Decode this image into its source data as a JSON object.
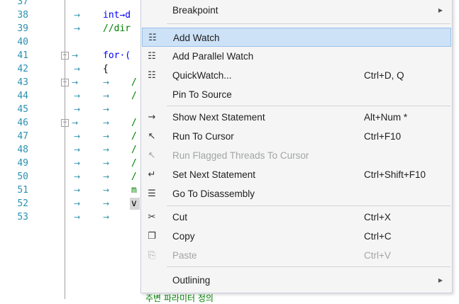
{
  "editor": {
    "lines": [
      {
        "num": "37",
        "code": ""
      },
      {
        "num": "38",
        "code": "int→d"
      },
      {
        "num": "39",
        "code": "//dir"
      },
      {
        "num": "40",
        "code": ""
      },
      {
        "num": "41",
        "code": "for·("
      },
      {
        "num": "42",
        "code": "{"
      },
      {
        "num": "43",
        "code": "/"
      },
      {
        "num": "44",
        "code": "/"
      },
      {
        "num": "45",
        "code": ""
      },
      {
        "num": "46",
        "code": "/"
      },
      {
        "num": "47",
        "code": "/"
      },
      {
        "num": "48",
        "code": "/"
      },
      {
        "num": "49",
        "code": "/"
      },
      {
        "num": "50",
        "code": "/"
      },
      {
        "num": "51",
        "code": "m"
      },
      {
        "num": "52",
        "code": "v"
      },
      {
        "num": "53",
        "code": ""
      }
    ],
    "tab_glyph": "→",
    "fold_glyph": "−",
    "bottom_partial": "주변 파라미터 정의"
  },
  "menu": {
    "items": [
      {
        "label": "Breakpoint",
        "shortcut": "",
        "icon": "",
        "has_sub": true,
        "disabled": false,
        "selected": false
      },
      {
        "label": "Add Watch",
        "shortcut": "",
        "icon": "☷",
        "has_sub": false,
        "disabled": false,
        "selected": true
      },
      {
        "label": "Add Parallel Watch",
        "shortcut": "",
        "icon": "☷",
        "has_sub": false,
        "disabled": false,
        "selected": false
      },
      {
        "label": "QuickWatch...",
        "shortcut": "Ctrl+D, Q",
        "icon": "☷",
        "has_sub": false,
        "disabled": false,
        "selected": false
      },
      {
        "label": "Pin To Source",
        "shortcut": "",
        "icon": "",
        "has_sub": false,
        "disabled": false,
        "selected": false
      },
      {
        "label": "Show Next Statement",
        "shortcut": "Alt+Num *",
        "icon": "→",
        "has_sub": false,
        "disabled": false,
        "selected": false
      },
      {
        "label": "Run To Cursor",
        "shortcut": "Ctrl+F10",
        "icon": "↖",
        "has_sub": false,
        "disabled": false,
        "selected": false
      },
      {
        "label": "Run Flagged Threads To Cursor",
        "shortcut": "",
        "icon": "↖",
        "has_sub": false,
        "disabled": true,
        "selected": false
      },
      {
        "label": "Set Next Statement",
        "shortcut": "Ctrl+Shift+F10",
        "icon": "↵",
        "has_sub": false,
        "disabled": false,
        "selected": false
      },
      {
        "label": "Go To Disassembly",
        "shortcut": "",
        "icon": "☰",
        "has_sub": false,
        "disabled": false,
        "selected": false
      },
      {
        "label": "Cut",
        "shortcut": "Ctrl+X",
        "icon": "✂",
        "has_sub": false,
        "disabled": false,
        "selected": false
      },
      {
        "label": "Copy",
        "shortcut": "Ctrl+C",
        "icon": "❐",
        "has_sub": false,
        "disabled": false,
        "selected": false
      },
      {
        "label": "Paste",
        "shortcut": "Ctrl+V",
        "icon": "⎘",
        "has_sub": false,
        "disabled": true,
        "selected": false
      },
      {
        "label": "Outlining",
        "shortcut": "",
        "icon": "",
        "has_sub": true,
        "disabled": false,
        "selected": false
      }
    ],
    "submenu_glyph": "▶"
  },
  "colors": {
    "line_number": "#2b91af",
    "keyword": "#0000ff",
    "comment": "#008000",
    "menu_bg": "#f5f5f5",
    "selected_bg": "#cde2f7",
    "disabled_text": "#a2a4a5"
  }
}
